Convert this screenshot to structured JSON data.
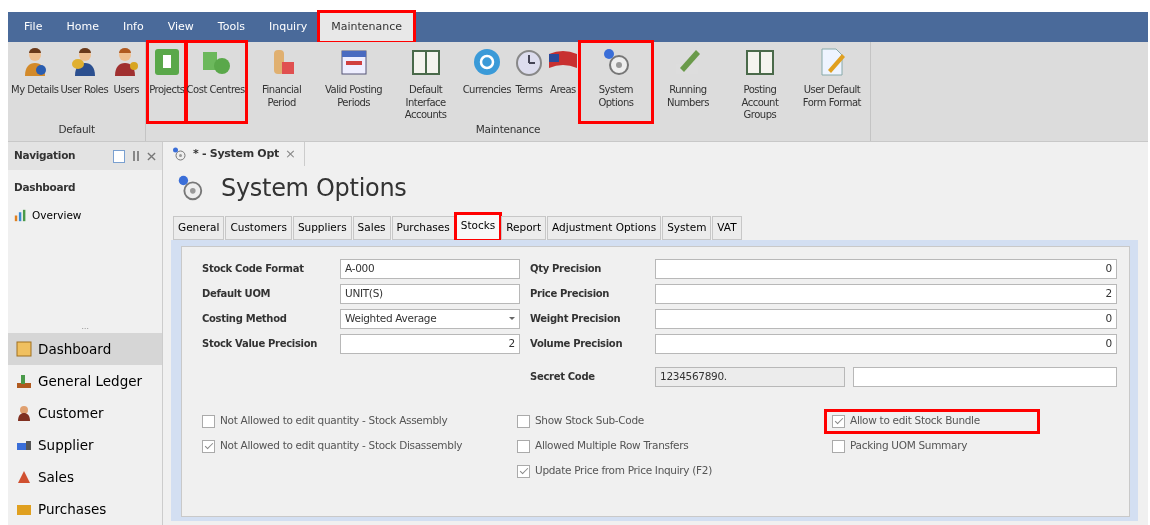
{
  "menu": [
    {
      "label": "File",
      "selected": false,
      "highlighted": false
    },
    {
      "label": "Home",
      "selected": false,
      "highlighted": false
    },
    {
      "label": "Info",
      "selected": false,
      "highlighted": false
    },
    {
      "label": "View",
      "selected": false,
      "highlighted": false
    },
    {
      "label": "Tools",
      "selected": false,
      "highlighted": false
    },
    {
      "label": "Inquiry",
      "selected": false,
      "highlighted": false
    },
    {
      "label": "Maintenance",
      "selected": true,
      "highlighted": true
    }
  ],
  "ribbon": [
    {
      "group": "Default",
      "items": [
        {
          "label": "My Details",
          "highlighted": false
        },
        {
          "label": "User Roles",
          "highlighted": false
        },
        {
          "label": "Users",
          "highlighted": false
        }
      ]
    },
    {
      "group": "Maintenance",
      "items": [
        {
          "label": "Projects",
          "highlighted": true
        },
        {
          "label": "Cost Centres",
          "highlighted": true
        },
        {
          "label": "Financial Period",
          "highlighted": false
        },
        {
          "label": "Valid Posting Periods",
          "highlighted": false
        },
        {
          "label": "Default Interface Accounts",
          "highlighted": false
        },
        {
          "label": "Currencies",
          "highlighted": false
        },
        {
          "label": "Terms",
          "highlighted": false
        },
        {
          "label": "Areas",
          "highlighted": false
        },
        {
          "label": "System Options",
          "highlighted": true
        },
        {
          "label": "Running Numbers",
          "highlighted": false
        },
        {
          "label": "Posting Account Groups",
          "highlighted": false
        },
        {
          "label": "User Default Form Format",
          "highlighted": false
        }
      ]
    }
  ],
  "navigation": {
    "title": "Navigation",
    "section": "Dashboard",
    "links": [
      {
        "label": "Overview"
      }
    ],
    "grip": "...",
    "items": [
      {
        "label": "Dashboard",
        "selected": true
      },
      {
        "label": "General Ledger",
        "selected": false
      },
      {
        "label": "Customer",
        "selected": false
      },
      {
        "label": "Supplier",
        "selected": false
      },
      {
        "label": "Sales",
        "selected": false
      },
      {
        "label": "Purchases",
        "selected": false
      }
    ]
  },
  "document_tab": {
    "label": "* - System Opt",
    "close": "×"
  },
  "page_title": "System Options",
  "tabs": [
    {
      "label": "General",
      "selected": false,
      "highlighted": false
    },
    {
      "label": "Customers",
      "selected": false,
      "highlighted": false
    },
    {
      "label": "Suppliers",
      "selected": false,
      "highlighted": false
    },
    {
      "label": "Sales",
      "selected": false,
      "highlighted": false
    },
    {
      "label": "Purchases",
      "selected": false,
      "highlighted": false
    },
    {
      "label": "Stocks",
      "selected": true,
      "highlighted": true
    },
    {
      "label": "Report",
      "selected": false,
      "highlighted": false
    },
    {
      "label": "Adjustment Options",
      "selected": false,
      "highlighted": false
    },
    {
      "label": "System",
      "selected": false,
      "highlighted": false
    },
    {
      "label": "VAT",
      "selected": false,
      "highlighted": false
    }
  ],
  "left_fields": [
    {
      "label": "Stock Code Format",
      "value": "A-000",
      "kind": "text"
    },
    {
      "label": "Default UOM",
      "value": "UNIT(S)",
      "kind": "text"
    },
    {
      "label": "Costing Method",
      "value": "Weighted Average",
      "kind": "dropdown"
    },
    {
      "label": "Stock Value Precision",
      "value": "2",
      "kind": "number"
    }
  ],
  "right_fields": [
    {
      "label": "Qty Precision",
      "value": "0",
      "kind": "number"
    },
    {
      "label": "Price Precision",
      "value": "2",
      "kind": "number"
    },
    {
      "label": "Weight Precision",
      "value": "0",
      "kind": "number"
    },
    {
      "label": "Volume Precision",
      "value": "0",
      "kind": "number"
    }
  ],
  "secret_code": {
    "label": "Secret Code",
    "value": "1234567890."
  },
  "checkbox_columns": [
    [
      {
        "label": "Not Allowed to edit quantity - Stock Assembly",
        "checked": false,
        "highlighted": false
      },
      {
        "label": "Not Allowed to edit quantity - Stock Disassembly",
        "checked": true,
        "highlighted": false
      }
    ],
    [
      {
        "label": "Show Stock Sub-Code",
        "checked": false,
        "highlighted": false
      },
      {
        "label": "Allowed Multiple Row Transfers",
        "checked": false,
        "highlighted": false
      },
      {
        "label": "Update Price from Price Inquiry (F2)",
        "checked": true,
        "highlighted": false
      }
    ],
    [
      {
        "label": "Allow to edit Stock Bundle",
        "checked": true,
        "highlighted": true
      },
      {
        "label": "Packing UOM Summary",
        "checked": false,
        "highlighted": false
      }
    ]
  ]
}
